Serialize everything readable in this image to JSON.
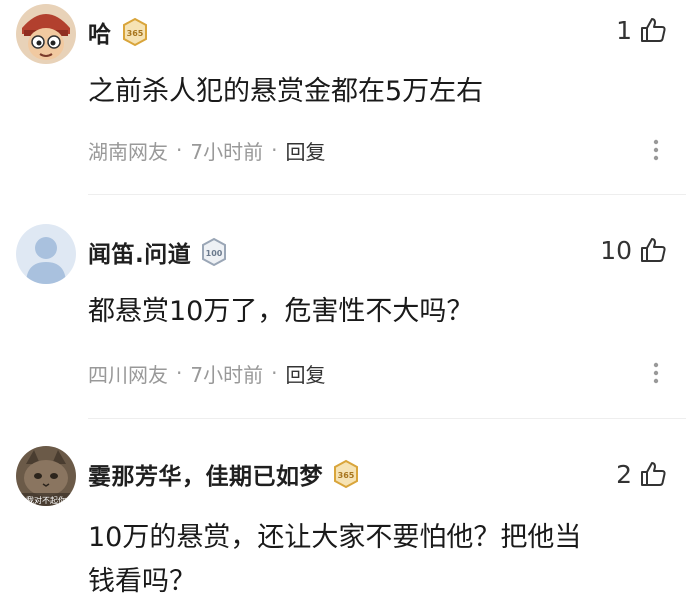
{
  "comments": [
    {
      "username": "哈",
      "badge": "365",
      "likes": "1",
      "text": "之前杀人犯的悬赏金都在5万左右",
      "location": "湖南网友",
      "time": "7小时前",
      "reply": "回复",
      "avatar_icon": "cartoon-boy-avatar"
    },
    {
      "username": "闻笛.问道",
      "badge": "100",
      "likes": "10",
      "text": "都悬赏10万了，危害性不大吗？",
      "location": "四川网友",
      "time": "7小时前",
      "reply": "回复",
      "avatar_icon": "default-person-avatar"
    },
    {
      "username": "霎那芳华，佳期已如梦",
      "badge": "365",
      "likes": "2",
      "text_line1": "10万的悬赏，还让大家不要怕他？把他当",
      "text_line2": "钱看吗？",
      "avatar_caption": "我对不起你",
      "avatar_icon": "cat-meme-avatar"
    }
  ],
  "colors": {
    "meta_text": "#999999",
    "badge_gold": "#d9a53b",
    "divider": "#eeeeee"
  }
}
